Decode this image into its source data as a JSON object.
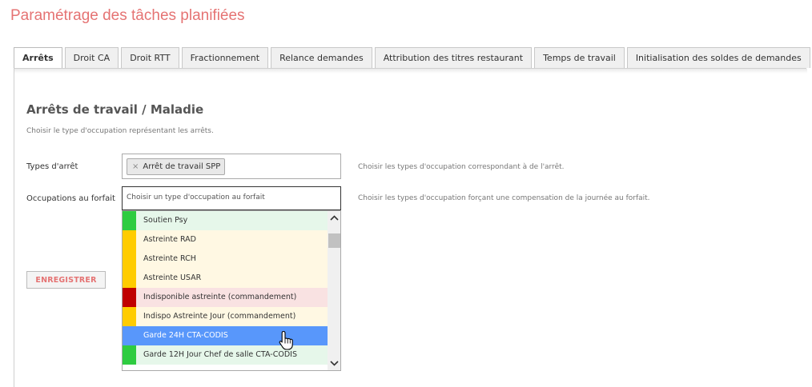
{
  "page": {
    "title": "Paramétrage des tâches planifiées"
  },
  "tabs": [
    {
      "label": "Arrêts",
      "active": true
    },
    {
      "label": "Droit CA"
    },
    {
      "label": "Droit RTT"
    },
    {
      "label": "Fractionnement"
    },
    {
      "label": "Relance demandes"
    },
    {
      "label": "Attribution des titres restaurant"
    },
    {
      "label": "Temps de travail"
    },
    {
      "label": "Initialisation des soldes de demandes"
    }
  ],
  "section": {
    "title": "Arrêts de travail / Maladie",
    "description": "Choisir le type d'occupation représentant les arrêts."
  },
  "types_arret": {
    "label": "Types d'arrêt",
    "selected_chip": "Arrêt de travail SPP",
    "chip_remove": "×",
    "help": "Choisir les types d'occupation correspondant à de l'arrêt."
  },
  "occupations_forfait": {
    "label": "Occupations au forfait",
    "placeholder": "Choisir un type d'occupation au forfait",
    "help": "Choisir les types d'occupation forçant une compensation de la journée au forfait."
  },
  "dropdown": {
    "options": [
      {
        "label": "Soutien Psy",
        "color": "#2ecc40",
        "bg": "#e6f7ea"
      },
      {
        "label": "Astreinte RAD",
        "color": "#ffcc00",
        "bg": "#fff8e3"
      },
      {
        "label": "Astreinte RCH",
        "color": "#ffcc00",
        "bg": "#fff8e3"
      },
      {
        "label": "Astreinte USAR",
        "color": "#ffcc00",
        "bg": "#fff8e3"
      },
      {
        "label": "Indisponible astreinte (commandement)",
        "color": "#c00000",
        "bg": "#f9e2e2"
      },
      {
        "label": "Indispo Astreinte Jour (commandement)",
        "color": "#ffcc00",
        "bg": "#fff8e3"
      },
      {
        "label": "Garde 24H CTA-CODIS",
        "color": "#5897fb",
        "bg": "#5897fb",
        "selected": true
      },
      {
        "label": "Garde 12H Jour Chef de salle CTA-CODIS",
        "color": "#2ecc40",
        "bg": "#e6f7ea"
      }
    ],
    "scroll_up_icon": "chevron-up",
    "scroll_down_icon": "chevron-down"
  },
  "actions": {
    "save_label": "ENREGISTRER"
  }
}
